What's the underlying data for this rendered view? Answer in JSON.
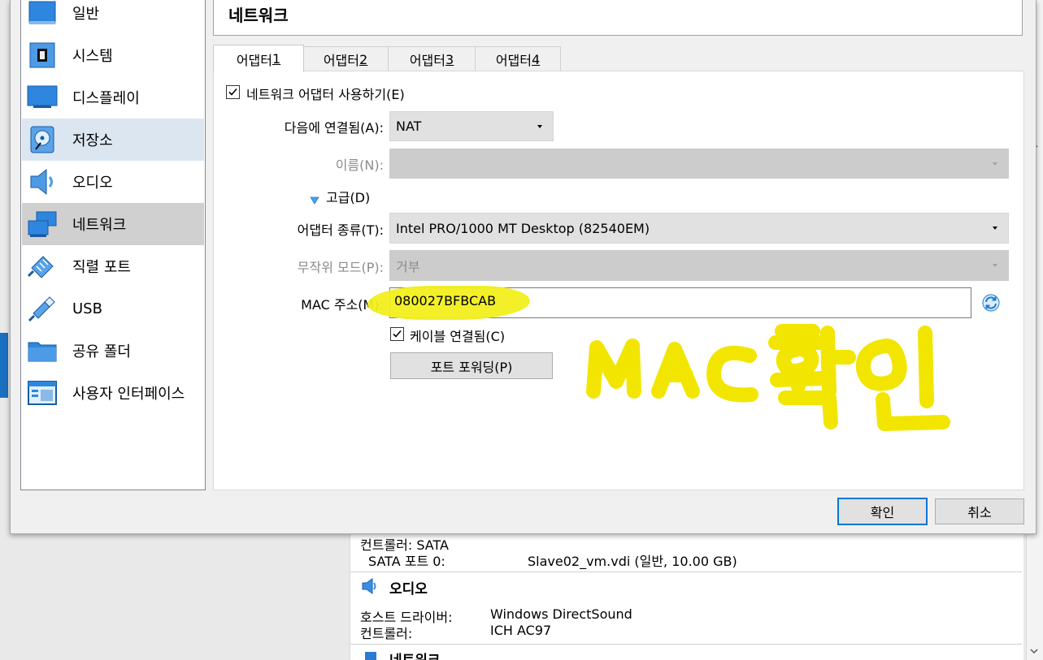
{
  "sidebar": {
    "items": [
      {
        "label": "일반",
        "icon": "general-icon"
      },
      {
        "label": "시스템",
        "icon": "system-chip-icon"
      },
      {
        "label": "디스플레이",
        "icon": "display-monitor-icon"
      },
      {
        "label": "저장소",
        "icon": "storage-disk-icon"
      },
      {
        "label": "오디오",
        "icon": "audio-speaker-icon"
      },
      {
        "label": "네트워크",
        "icon": "network-icon"
      },
      {
        "label": "직렬 포트",
        "icon": "serial-port-icon"
      },
      {
        "label": "USB",
        "icon": "usb-icon"
      },
      {
        "label": "공유 폴더",
        "icon": "shared-folder-icon"
      },
      {
        "label": "사용자 인터페이스",
        "icon": "user-interface-icon"
      }
    ],
    "hovered": "저장소",
    "selected": "네트워크"
  },
  "section": {
    "title": "네트워크"
  },
  "tabs": [
    {
      "label": "어댑터 ",
      "key": "1"
    },
    {
      "label": "어댑터 ",
      "key": "2"
    },
    {
      "label": "어댑터 ",
      "key": "3"
    },
    {
      "label": "어댑터 ",
      "key": "4"
    }
  ],
  "adapter": {
    "enable_label": "네트워크 어댑터 사용하기(E)",
    "enable_checked": true,
    "attached_label": "다음에 연결됨(A):",
    "attached_value": "NAT",
    "name_label": "이름(N):",
    "name_value": "",
    "advanced_label": "고급(D)",
    "adapter_type_label": "어댑터 종류(T):",
    "adapter_type_value": "Intel PRO/1000 MT Desktop (82540EM)",
    "promiscuous_label": "무작위 모드(P):",
    "promiscuous_value": "거부",
    "mac_label": "MAC 주소(M):",
    "mac_value": "080027BFBCAB",
    "refresh_icon": "refresh-mac-icon",
    "cable_label": "케이블 연결됨(C)",
    "cable_checked": true,
    "port_forwarding_label": "포트 포워딩(P)"
  },
  "annotation": {
    "text": "MAC확인",
    "color": "#f2e600"
  },
  "buttons": {
    "ok": "확인",
    "cancel": "취소"
  },
  "background_details": {
    "controller_line": "컨트롤러: SATA",
    "sata_port_label": "SATA 포트 0:",
    "sata_port_value": "Slave02_vm.vdi (일반, 10.00 GB)",
    "audio_title": "오디오",
    "host_driver_label": "호스트 드라이버:",
    "host_driver_value": "Windows DirectSound",
    "controller_label": "컨트롤러:",
    "controller_value": "ICH AC97",
    "network_title": "네트워크"
  }
}
